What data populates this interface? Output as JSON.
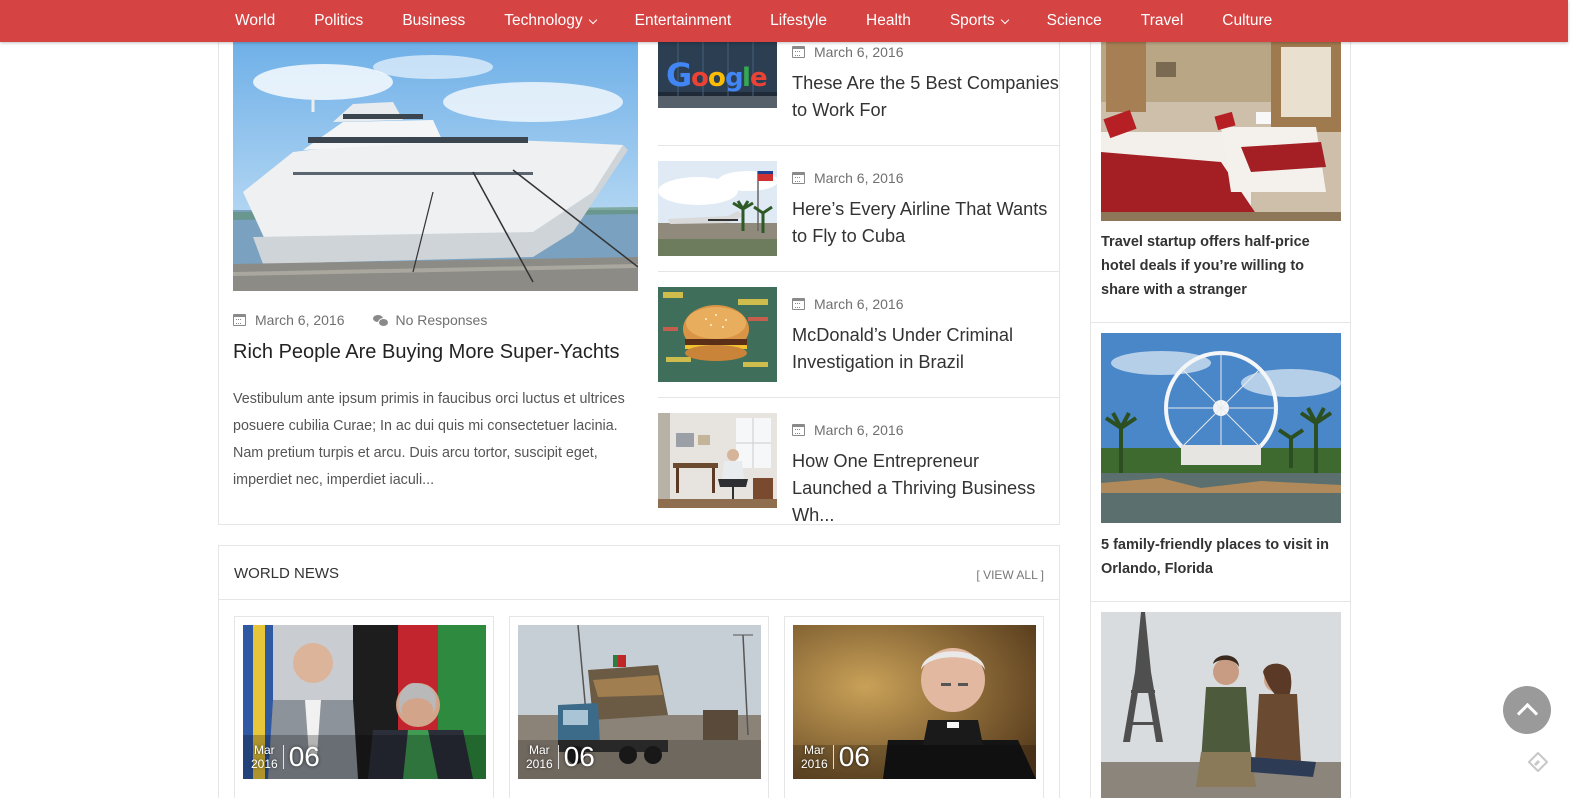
{
  "nav": {
    "items": [
      {
        "label": "World"
      },
      {
        "label": "Politics"
      },
      {
        "label": "Business"
      },
      {
        "label": "Technology"
      },
      {
        "label": "Entertainment"
      },
      {
        "label": "Lifestyle"
      },
      {
        "label": "Health"
      },
      {
        "label": "Sports"
      },
      {
        "label": "Science"
      },
      {
        "label": "Travel"
      },
      {
        "label": "Culture"
      }
    ],
    "dropdown_items": [
      "Technology",
      "Sports"
    ],
    "bar_color": "#d54343"
  },
  "featured": {
    "main": {
      "date": "March 6, 2016",
      "responses": "No Responses",
      "title": "Rich People Are Buying More Super-Yachts",
      "excerpt": "Vestibulum ante ipsum primis in faucibus orci luctus et ultrices posuere cubilia Curae; In ac dui quis mi consectetuer lacinia. Nam pretium turpis et arcu. Duis arcu tortor, suscipit eget, imperdiet nec, imperdiet iaculi..."
    },
    "side": [
      {
        "date": "March 6, 2016",
        "title": "These Are the 5 Best Companies to Work For",
        "image": "google-sign-photo"
      },
      {
        "date": "March 6, 2016",
        "title": "Here’s Every Airline That Wants to Fly to Cuba",
        "image": "airport-photo"
      },
      {
        "date": "March 6, 2016",
        "title": "McDonald’s Under Criminal Investigation in Brazil",
        "image": "burger-photo"
      },
      {
        "date": "March 6, 2016",
        "title": "How One Entrepreneur Launched a Thriving Business Wh...",
        "image": "office-photo"
      }
    ]
  },
  "world_news": {
    "title": "WORLD NEWS",
    "view_all": "[ VIEW ALL ]",
    "cards": [
      {
        "month": "Mar",
        "year": "2016",
        "day": "06",
        "image": "politicians-photo"
      },
      {
        "month": "Mar",
        "year": "2016",
        "day": "06",
        "image": "truck-photo"
      },
      {
        "month": "Mar",
        "year": "2016",
        "day": "06",
        "image": "priest-photo"
      }
    ]
  },
  "sidebar": {
    "items": [
      {
        "title": "Travel startup offers half-price hotel deals if you’re willing to share with a stranger",
        "image": "hotel-room-photo"
      },
      {
        "title": "5 family-friendly places to visit in Orlando, Florida",
        "image": "ferris-wheel-photo"
      },
      {
        "title": "",
        "image": "eiffel-couple-photo"
      }
    ]
  },
  "icons": {
    "date": "calendar-icon",
    "comments": "comments-icon",
    "scroll_top": "chevron-up-icon",
    "feed": "feedly-icon"
  }
}
